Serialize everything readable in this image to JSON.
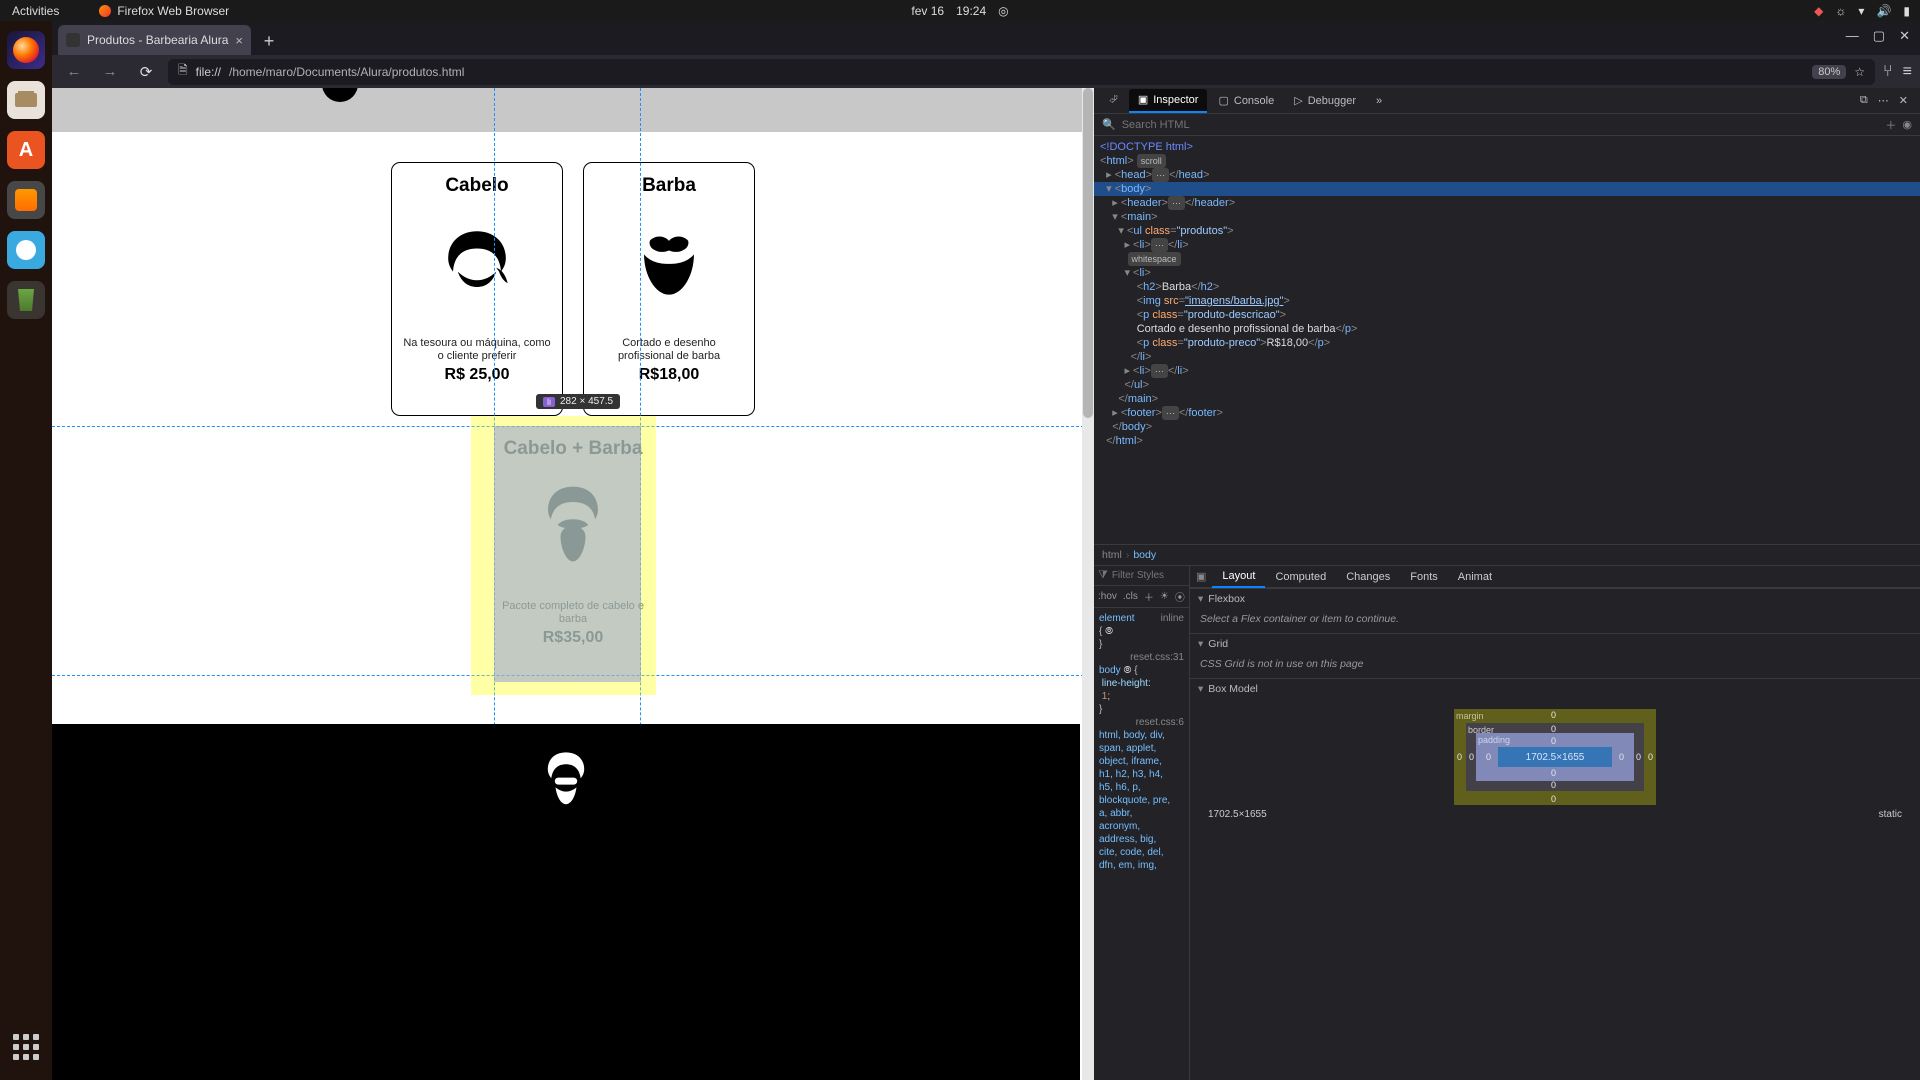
{
  "gnome": {
    "activities": "Activities",
    "app_name": "Firefox Web Browser",
    "date": "fev 16",
    "time": "19:24"
  },
  "browser": {
    "tab_title": "Produtos - Barbearia Alura",
    "url_prefix": "file://",
    "url_path": "/home/maro/Documents/Alura/produtos.html",
    "zoom": "80%"
  },
  "page": {
    "products": [
      {
        "title": "Cabelo",
        "desc": "Na tesoura ou máquina, como o cliente preferir",
        "price": "R$ 25,00"
      },
      {
        "title": "Barba",
        "desc": "Cortado e desenho profissional de barba",
        "price": "R$18,00"
      },
      {
        "title": "Cabelo + Barba",
        "desc": "Pacote completo de cabelo e barba",
        "price": "R$35,00"
      }
    ],
    "overlay_size": "282 × 457.5",
    "overlay_tag": "li"
  },
  "devtools": {
    "tabs": {
      "inspector": "Inspector",
      "console": "Console",
      "debugger": "Debugger"
    },
    "search_placeholder": "Search HTML",
    "dom": {
      "doctype": "<!DOCTYPE html>",
      "html_open": "html",
      "scroll_badge": "scroll",
      "head": "head",
      "body": "body",
      "header": "header",
      "main": "main",
      "ul_class": "class",
      "ul_classv": "\"produtos\"",
      "li": "li",
      "ws": "whitespace",
      "h2_text": "Barba",
      "img_attr": "src",
      "img_attrv": "\"imagens/barba.jpg\"",
      "p1_classv": "\"produto-descricao\"",
      "p1_text": "Cortado e desenho profissional de barba",
      "p2_classv": "\"produto-preco\"",
      "p2_text": "R$18,00",
      "footer": "footer"
    },
    "crumbs": {
      "a": "html",
      "b": "body"
    },
    "rules": {
      "filter_placeholder": "Filter Styles",
      "hov": ":hov",
      "cls": ".cls",
      "element_sel": "element",
      "inline": "inline",
      "src1": "reset.css:31",
      "body_sel": "body",
      "lh_prop": "line-height",
      "lh_val": "1",
      "src2": "reset.css:6",
      "long_sel1": "html, body, div,",
      "long_sel2": "span, applet,",
      "long_sel3": "object, iframe,",
      "long_sel4": "h1, h2, h3, h4,",
      "long_sel5": "h5, h6, p,",
      "long_sel6": "blockquote, pre,",
      "long_sel7": "a, abbr,",
      "long_sel8": "acronym,",
      "long_sel9": "address, big,",
      "long_sel10": "cite, code, del,",
      "long_sel11": "dfn, em, img,"
    },
    "side_tabs": {
      "layout": "Layout",
      "computed": "Computed",
      "changes": "Changes",
      "fonts": "Fonts",
      "anim": "Animat"
    },
    "flexbox": {
      "title": "Flexbox",
      "msg": "Select a Flex container or item to continue."
    },
    "grid": {
      "title": "Grid",
      "msg": "CSS Grid is not in use on this page"
    },
    "boxmodel": {
      "title": "Box Model",
      "margin": "margin",
      "border": "border",
      "padding": "padding",
      "content": "1702.5×1655",
      "zeros": "0",
      "dims": "1702.5×1655",
      "pos": "static"
    }
  }
}
